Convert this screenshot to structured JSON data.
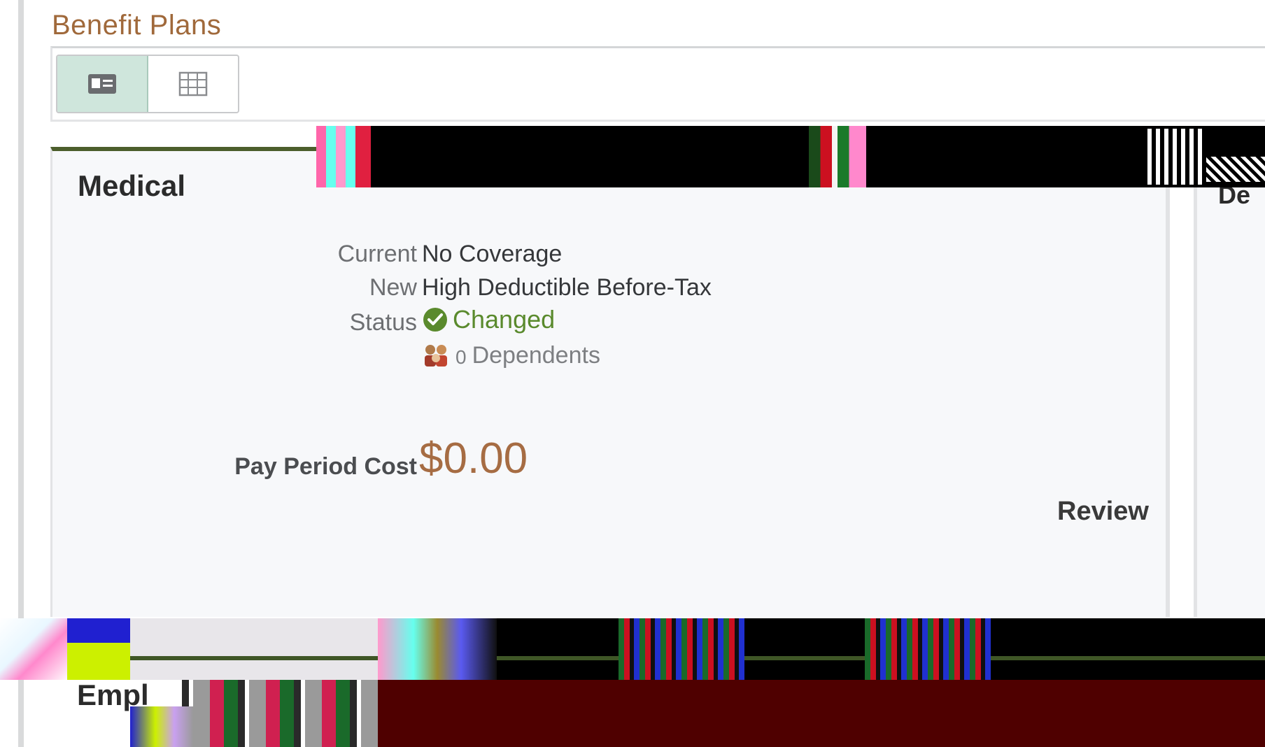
{
  "section": {
    "title": "Benefit Plans"
  },
  "view_toggle": {
    "card_view_icon": "id-card-icon",
    "grid_view_icon": "grid-icon",
    "active": "card"
  },
  "medical_card": {
    "title": "Medical",
    "current_label": "Current",
    "current_value": "No Coverage",
    "new_label": "New",
    "new_value": "High Deductible Before-Tax",
    "status_label": "Status",
    "status_value": "Changed",
    "status_icon": "check-circle-icon",
    "dependents_icon": "people-icon",
    "dependents_count": "0",
    "dependents_label": "Dependents",
    "cost_label": "Pay Period Cost",
    "cost_value": "$0.00",
    "review_label": "Review"
  },
  "next_card": {
    "title": "De"
  },
  "bottom_card": {
    "title": "Empl"
  },
  "colors": {
    "section_title": "#a0693b",
    "card_accent": "#4c5e2c",
    "status_green": "#5a8a2d",
    "cost_brown": "#a66c43",
    "toggle_active_bg": "#cfe6dc"
  }
}
